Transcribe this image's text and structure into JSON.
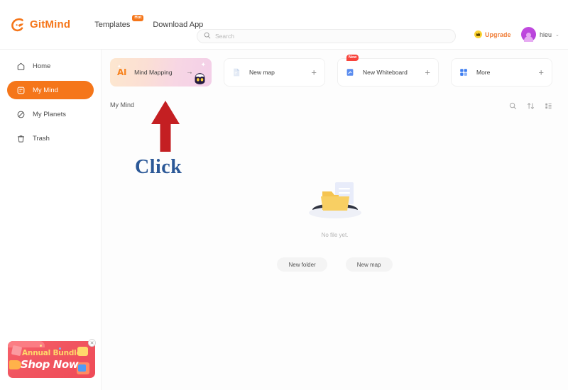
{
  "brand": {
    "name": "GitMind",
    "logo_icon": "gitmind-logo-icon",
    "accent": "#f5761a"
  },
  "topnav": {
    "templates": {
      "label": "Templates",
      "badge": "Hot"
    },
    "download": {
      "label": "Download App"
    }
  },
  "search": {
    "placeholder": "Search",
    "value": "",
    "icon": "search-icon"
  },
  "account": {
    "upgrade_label": "Upgrade",
    "upgrade_icon": "crown-icon",
    "user_name": "hieu",
    "chevron": "⌄",
    "avatar_icon": "user-avatar-icon"
  },
  "sidebar": {
    "items": [
      {
        "label": "Home",
        "icon": "home-icon",
        "active": false
      },
      {
        "label": "My Mind",
        "icon": "mind-doc-icon",
        "active": true
      },
      {
        "label": "My Planets",
        "icon": "planet-icon",
        "active": false
      },
      {
        "label": "Trash",
        "icon": "trash-icon",
        "active": false
      }
    ]
  },
  "promo": {
    "line1": "Annual Bundle",
    "line2": "Shop Now",
    "close_icon": "close-icon",
    "close_label": "✕",
    "color": "#ef4b58"
  },
  "cards": [
    {
      "id": "ai-mind-mapping",
      "ai_text": "AI",
      "label": "Mind Mapping",
      "action": "→",
      "badge": "",
      "icon": "ai-sparkle-icon"
    },
    {
      "id": "new-map",
      "ai_text": "",
      "label": "New map",
      "action": "+",
      "badge": "",
      "icon": "document-icon"
    },
    {
      "id": "new-whiteboard",
      "ai_text": "",
      "label": "New Whiteboard",
      "action": "+",
      "badge": "New",
      "icon": "whiteboard-icon"
    },
    {
      "id": "more",
      "ai_text": "",
      "label": "More",
      "action": "+",
      "badge": "",
      "icon": "grid-icon"
    }
  ],
  "section": {
    "title": "My Mind",
    "tools": [
      {
        "name": "search-icon",
        "label": "Search"
      },
      {
        "name": "sort-icon",
        "label": "Sort"
      },
      {
        "name": "view-list-icon",
        "label": "View"
      }
    ]
  },
  "empty_state": {
    "text": "No file yet.",
    "illustration": "empty-folder-icon",
    "buttons": [
      {
        "label": "New folder",
        "name": "new-folder-button"
      },
      {
        "label": "New map",
        "name": "new-map-button"
      }
    ]
  },
  "annotation": {
    "arrow": "up-arrow",
    "arrow_color": "#c41f22",
    "label": "Click",
    "label_color": "#2b5897"
  }
}
